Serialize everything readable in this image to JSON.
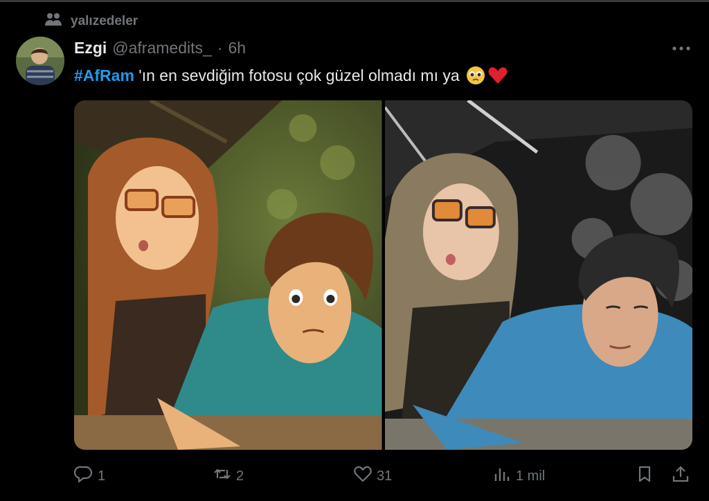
{
  "window": {
    "frame_color": "#3a3a3a"
  },
  "context": {
    "icon": "community-icon",
    "label": "yalızedeler"
  },
  "tweet": {
    "author_name": "Ezgi",
    "handle": "@aframedits_",
    "separator": "·",
    "time": "6h",
    "hashtag": "#AfRam",
    "text": " 'ın en sevdiğim fotosu çok güzel olmadı mı ya",
    "emojis": [
      "pleading-face-icon",
      "red-heart-icon"
    ],
    "more_icon": "more-dots-icon",
    "media": [
      {
        "icon": "illustrated-photo",
        "kind": "illustration"
      },
      {
        "icon": "real-photo",
        "kind": "photo"
      }
    ],
    "actions": {
      "replies": "1",
      "retweets": "2",
      "likes": "31",
      "views": "1 mil"
    }
  },
  "colors": {
    "background": "#000000",
    "text": "#e7e9ea",
    "muted": "#71767b",
    "accent": "#1d9bf0",
    "heart": "#f91880"
  }
}
